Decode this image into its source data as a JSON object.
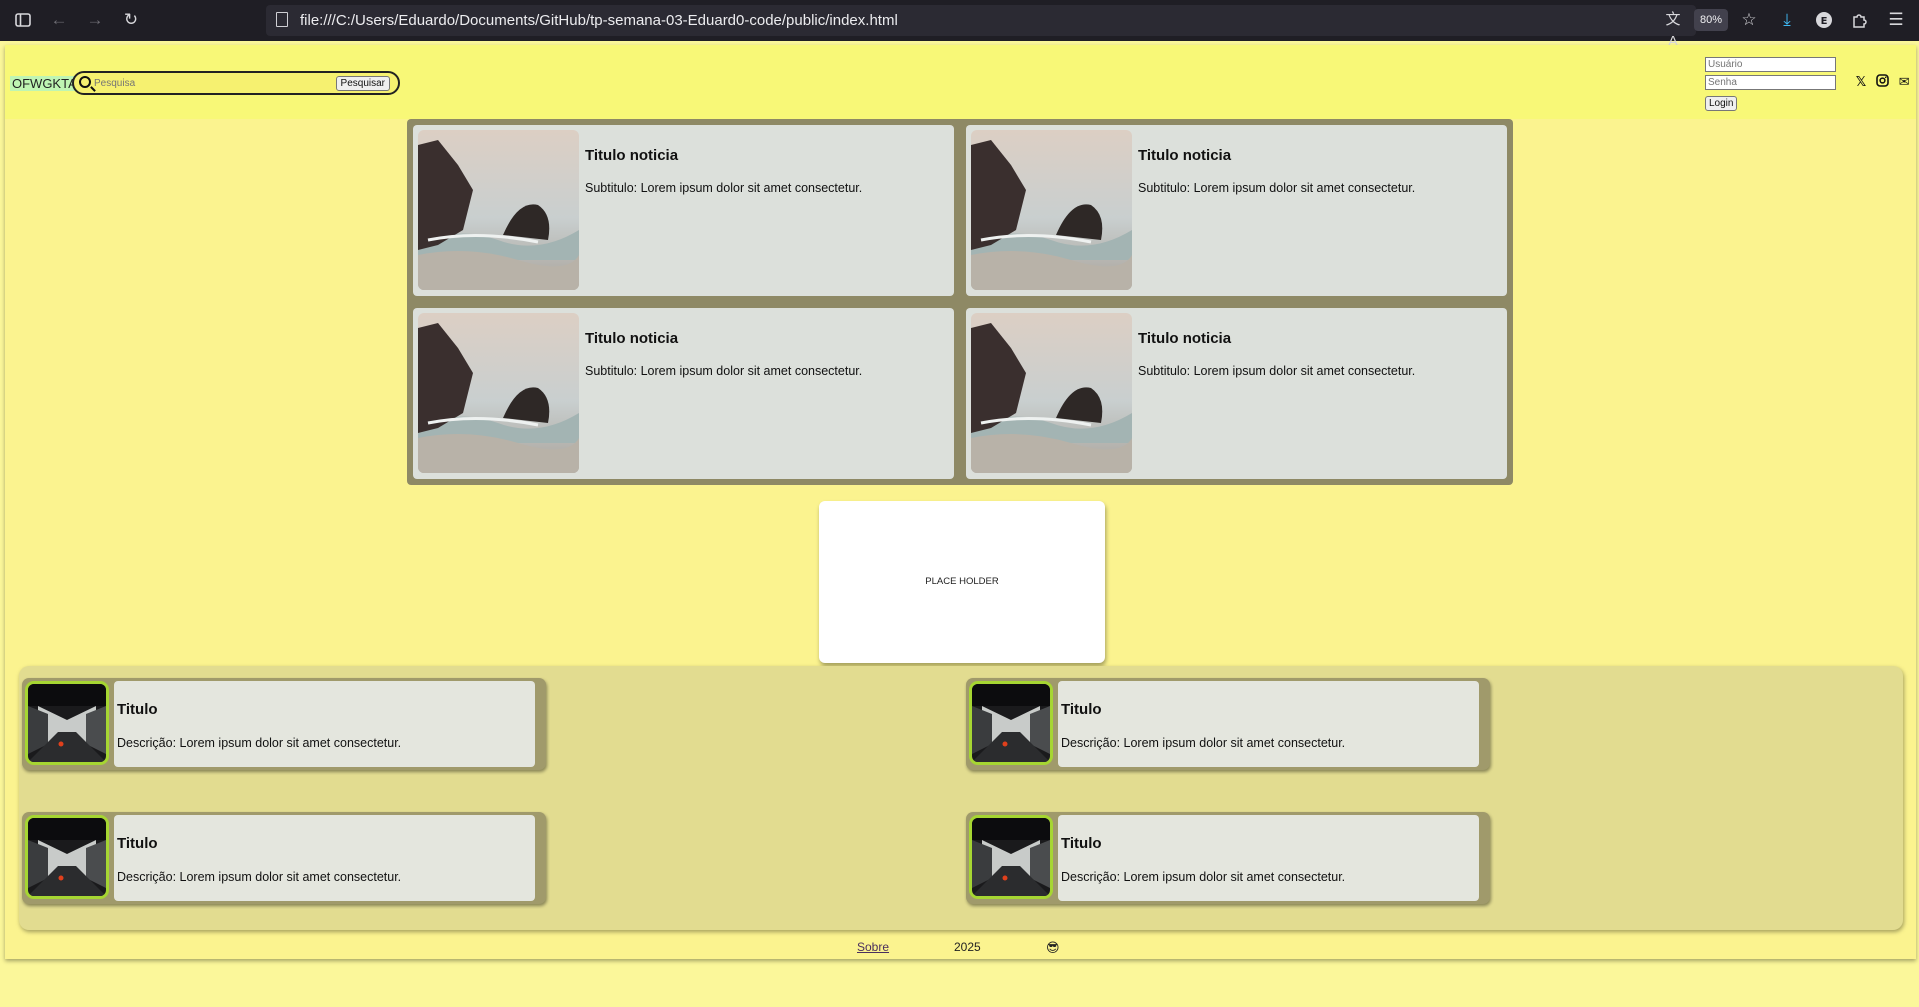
{
  "browser": {
    "url": "file:///C:/Users/Eduardo/Documents/GitHub/tp-semana-03-Eduard0-code/public/index.html",
    "zoom": "80%"
  },
  "header": {
    "logo": "OFWGKTA",
    "search_placeholder": "Pesquisa",
    "search_button": "Pesquisar",
    "user_placeholder": "Usuário",
    "password_placeholder": "Senha",
    "login_button": "Login",
    "social_icons": [
      "x-icon",
      "instagram-icon",
      "mail-icon"
    ]
  },
  "news": [
    {
      "title": "Titulo noticia",
      "subtitle": "Subtitulo: Lorem ipsum dolor sit amet consectetur."
    },
    {
      "title": "Titulo noticia",
      "subtitle": "Subtitulo: Lorem ipsum dolor sit amet consectetur."
    },
    {
      "title": "Titulo noticia",
      "subtitle": "Subtitulo: Lorem ipsum dolor sit amet consectetur."
    },
    {
      "title": "Titulo noticia",
      "subtitle": "Subtitulo: Lorem ipsum dolor sit amet consectetur."
    }
  ],
  "placeholder": "PLACE HOLDER",
  "items": [
    {
      "title": "Titulo",
      "description": "Descrição: Lorem ipsum dolor sit amet consectetur."
    },
    {
      "title": "Titulo",
      "description": "Descrição: Lorem ipsum dolor sit amet consectetur."
    },
    {
      "title": "Titulo",
      "description": "Descrição: Lorem ipsum dolor sit amet consectetur."
    },
    {
      "title": "Titulo",
      "description": "Descrição: Lorem ipsum dolor sit amet consectetur."
    }
  ],
  "footer": {
    "about": "Sobre",
    "year": "2025",
    "emoji": "😎"
  },
  "colors": {
    "page_bg": "#fbf38f",
    "header_bg": "#f8f877",
    "news_frame": "#8e8965",
    "card_bg": "#dce0db",
    "thumb_border": "#a6d632"
  }
}
